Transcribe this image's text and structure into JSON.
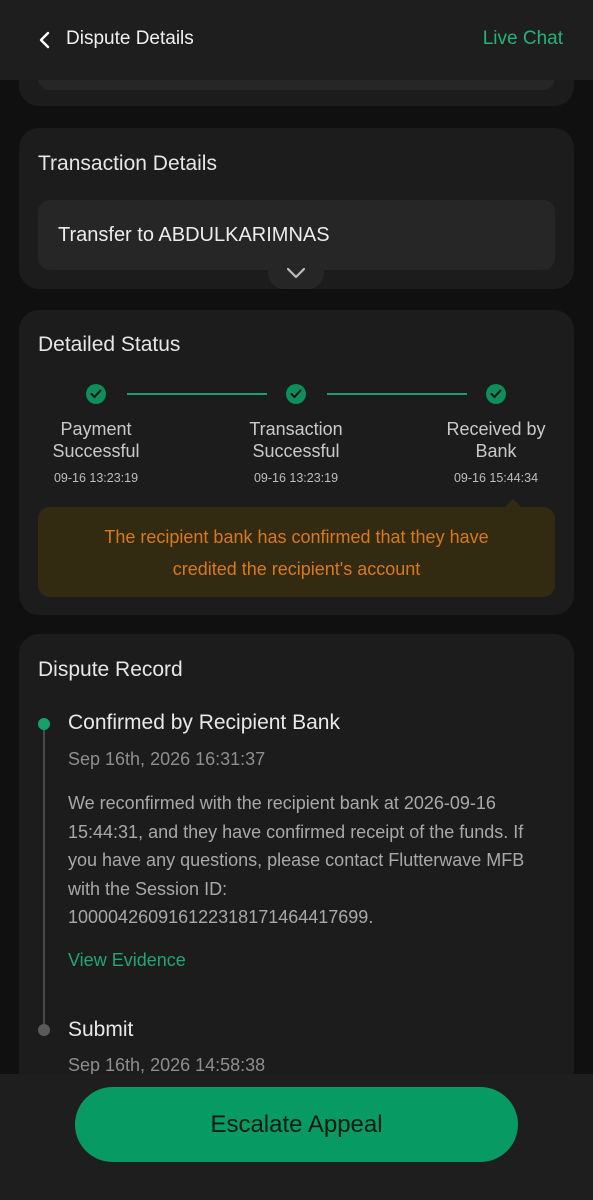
{
  "header": {
    "title": "Dispute Details",
    "live_chat": "Live Chat"
  },
  "transaction": {
    "title": "Transaction Details",
    "description": "Transfer to ABDULKARIMNAS"
  },
  "status": {
    "title": "Detailed Status",
    "steps": [
      {
        "line1": "Payment",
        "line2": "Successful",
        "time": "09-16 13:23:19"
      },
      {
        "line1": "Transaction",
        "line2": "Successful",
        "time": "09-16 13:23:19"
      },
      {
        "line1": "Received by",
        "line2": "Bank",
        "time": "09-16 15:44:34"
      }
    ],
    "note_line1": "The recipient bank has confirmed that they have",
    "note_line2": "credited the recipient's account",
    "accent_color": "#16a06a",
    "note_color": "#d9791f"
  },
  "record": {
    "title": "Dispute Record",
    "entries": [
      {
        "title": "Confirmed by Recipient Bank",
        "date": "Sep 16th, 2026 16:31:37",
        "body_lines": [
          "We reconfirmed with the recipient bank at 2026-09-16",
          "15:44:31, and they have confirmed receipt of the funds. If",
          "you have any questions, please contact Flutterwave MFB",
          "with the Session ID:",
          "100004260916122318171464417699."
        ],
        "link": "View Evidence"
      },
      {
        "title": "Submit",
        "date": "Sep 16th, 2026 14:58:38"
      }
    ]
  },
  "footer": {
    "escalate_label": "Escalate Appeal",
    "button_color": "#089a63"
  }
}
